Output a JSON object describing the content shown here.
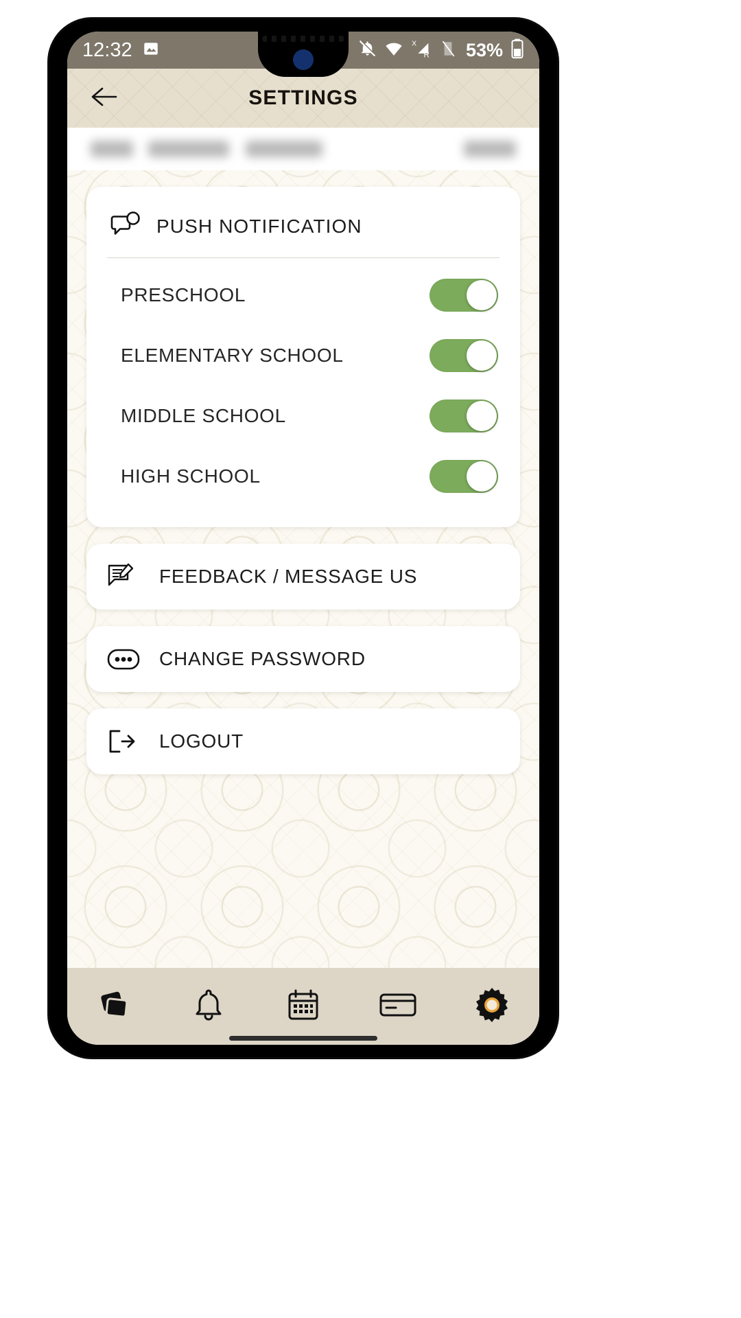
{
  "status_bar": {
    "time": "12:32",
    "battery_percent": "53%",
    "icons": [
      "image-icon",
      "bell-muted-icon",
      "wifi-icon",
      "signal-roaming-icon",
      "sim-off-icon",
      "battery-icon"
    ]
  },
  "header": {
    "title": "SETTINGS",
    "back_icon": "arrow-left-icon"
  },
  "user_strip": {
    "redacted": true,
    "note": ""
  },
  "push_card": {
    "icon": "chat-bubble-notification-icon",
    "title": "PUSH NOTIFICATION",
    "toggles": [
      {
        "label": "PRESCHOOL",
        "state": "on"
      },
      {
        "label": "ELEMENTARY SCHOOL",
        "state": "on"
      },
      {
        "label": "MIDDLE SCHOOL",
        "state": "on"
      },
      {
        "label": "HIGH SCHOOL",
        "state": "on"
      }
    ]
  },
  "actions": [
    {
      "label": "FEEDBACK / MESSAGE US",
      "icon": "message-edit-icon"
    },
    {
      "label": "CHANGE PASSWORD",
      "icon": "dots-rounded-icon"
    },
    {
      "label": "LOGOUT",
      "icon": "logout-arrow-icon"
    }
  ],
  "bottom_nav": [
    {
      "icon": "cards-icon",
      "active": false
    },
    {
      "icon": "bell-icon",
      "active": false
    },
    {
      "icon": "calendar-icon",
      "active": false
    },
    {
      "icon": "credit-card-icon",
      "active": false
    },
    {
      "icon": "gear-icon",
      "active": true
    }
  ],
  "colors": {
    "toggle_on": "#7cab5b",
    "header_bg": "#e6dfce",
    "nav_bg": "#ddd6c6",
    "status_bg": "#7e776a",
    "gear_accent": "#e8a33d"
  }
}
